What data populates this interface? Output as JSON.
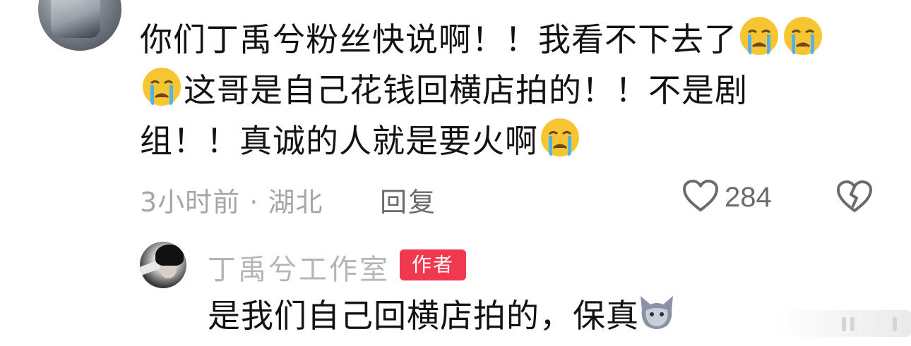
{
  "comment": {
    "line1_text": "你们丁禹兮粉丝快说啊！！我看不下去了",
    "line2_text": "这哥是自己花钱回横店拍的！！不是剧",
    "line3_text": "组！！真诚的人就是要火啊",
    "emoji": "loudly-crying-face-icon",
    "time": "3小时前",
    "separator": "·",
    "location": "湖北",
    "reply_label": "回复",
    "like_count": "284"
  },
  "reply": {
    "author": "丁禹兮工作室",
    "badge": "作者",
    "text": "是我们自己回横店拍的，保真",
    "emoji": "cat-face-icon"
  },
  "colors": {
    "badge": "#f0384e",
    "muted": "#a6a6a6",
    "text": "#121212"
  }
}
